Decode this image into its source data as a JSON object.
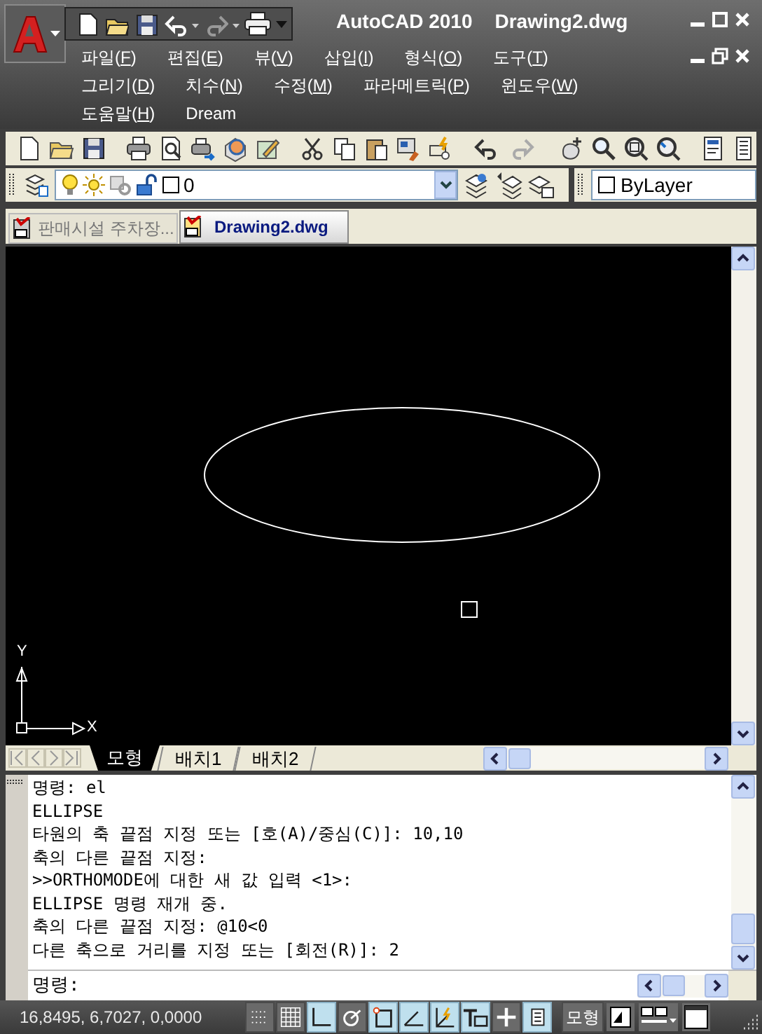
{
  "title_bar": {
    "app_title": "AutoCAD 2010",
    "document_title": "Drawing2.dwg"
  },
  "menu_rows": [
    [
      {
        "label": "파일(F)"
      },
      {
        "label": "편집(E)"
      },
      {
        "label": "뷰(V)"
      },
      {
        "label": "삽입(I)"
      },
      {
        "label": "형식(O)"
      },
      {
        "label": "도구(T)"
      }
    ],
    [
      {
        "label": "그리기(D)"
      },
      {
        "label": "치수(N)"
      },
      {
        "label": "수정(M)"
      },
      {
        "label": "파라메트릭(P)"
      },
      {
        "label": "윈도우(W)"
      }
    ],
    [
      {
        "label": "도움말(H)"
      },
      {
        "label": "Dream"
      }
    ]
  ],
  "layer_bar": {
    "current_layer": "0",
    "linetype": "ByLayer"
  },
  "document_tabs": [
    {
      "label": "판매시설 주차장...",
      "selected": false
    },
    {
      "label": "Drawing2.dwg",
      "selected": true
    }
  ],
  "ucs_icon": {
    "x_label": "X",
    "y_label": "Y"
  },
  "layout_tabs": [
    {
      "label": "모형",
      "selected": true
    },
    {
      "label": "배치1",
      "selected": false
    },
    {
      "label": "배치2",
      "selected": false
    }
  ],
  "command_history": [
    "명령: el",
    "ELLIPSE",
    "타원의 축 끝점 지정 또는 [호(A)/중심(C)]: 10,10",
    "축의 다른 끝점 지정:",
    ">>ORTHOMODE에 대한 새 값 입력 <1>:",
    "ELLIPSE 명령 재개 중.",
    "축의 다른 끝점 지정: @10<0",
    "다른 축으로 거리를 지정 또는 [회전(R)]: 2"
  ],
  "command_prompt": "명령:",
  "status_bar": {
    "coordinates": "16,8495, 6,7027, 0,0000",
    "toggles": [
      {
        "kind": "snap",
        "on": false
      },
      {
        "kind": "grid",
        "on": false
      },
      {
        "kind": "ortho",
        "on": true
      },
      {
        "kind": "polar",
        "on": false
      },
      {
        "kind": "osnap",
        "on": true
      },
      {
        "kind": "otrack",
        "on": true
      },
      {
        "kind": "ducs",
        "on": true
      },
      {
        "kind": "dyn",
        "on": true
      },
      {
        "kind": "lwt",
        "on": false
      },
      {
        "kind": "qp",
        "on": true
      }
    ],
    "space_button": "모형"
  }
}
